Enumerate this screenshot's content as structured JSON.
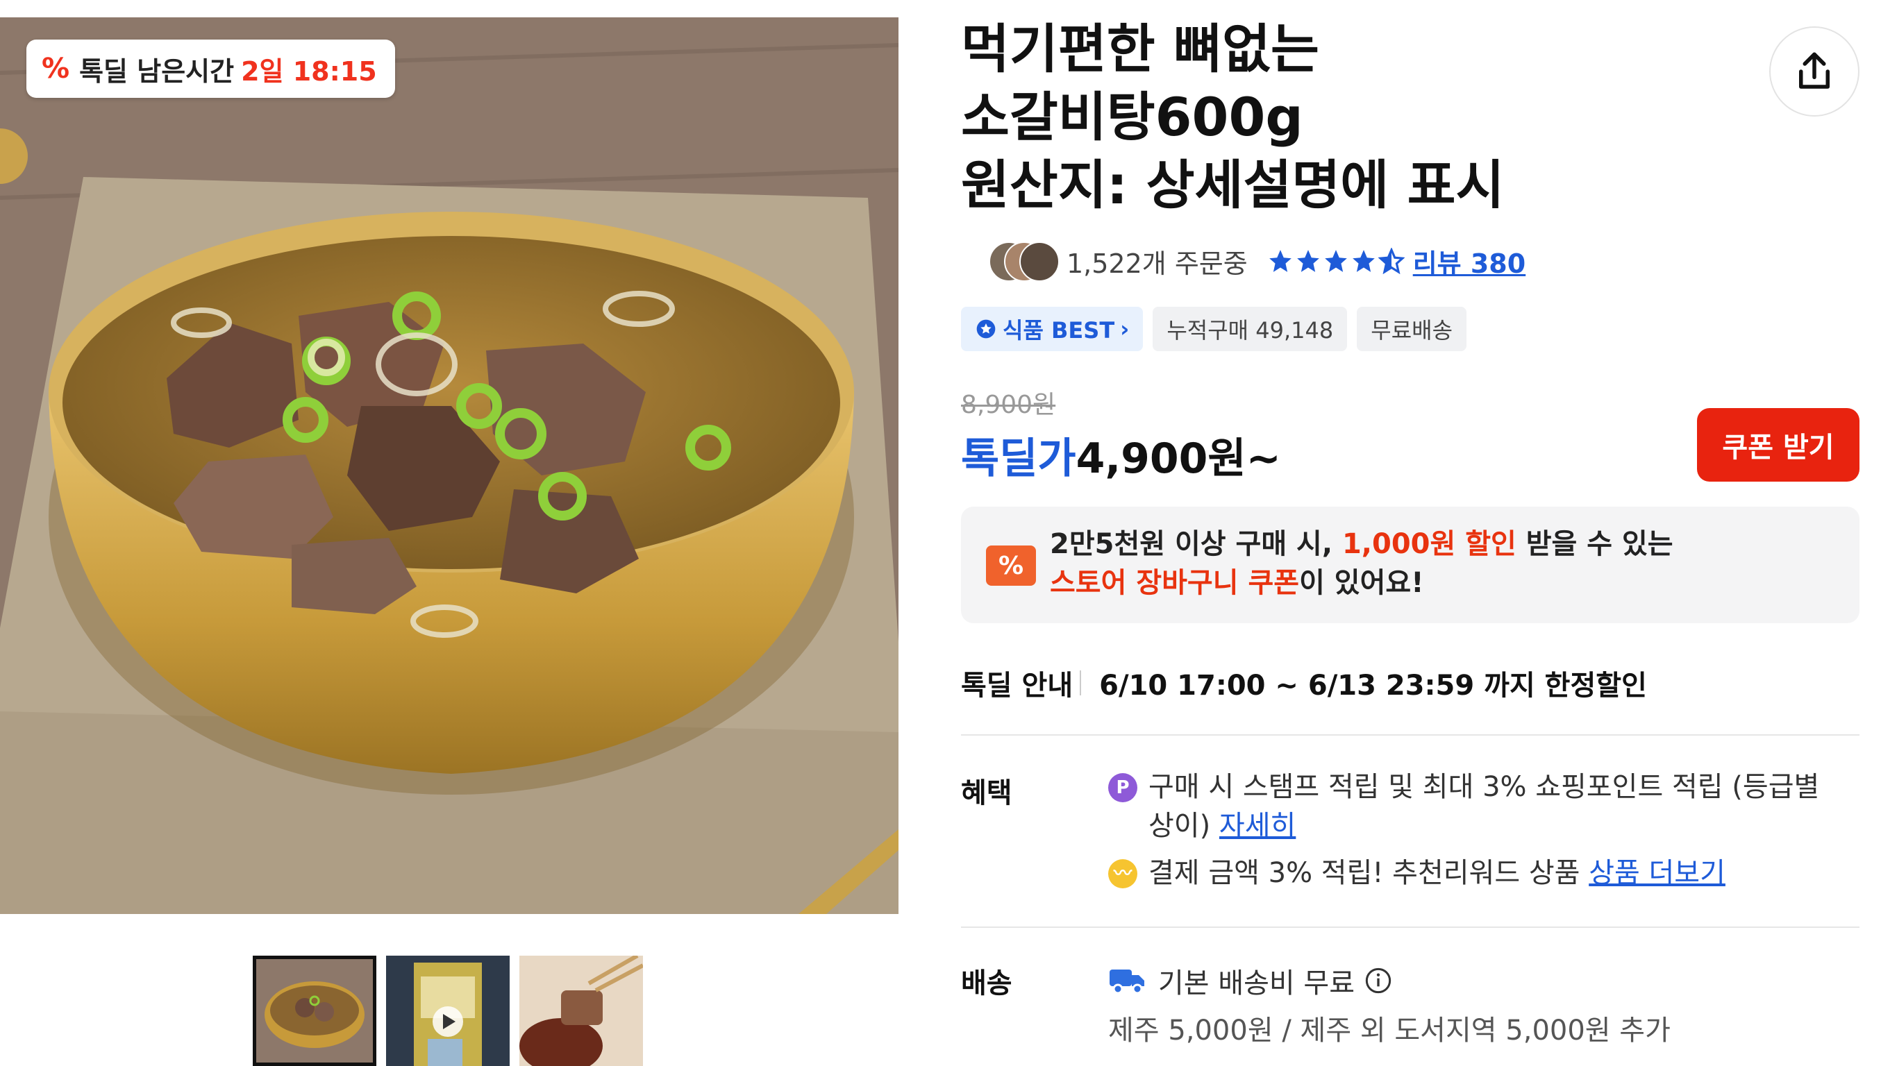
{
  "deal_timer": {
    "label": "톡딜 남은시간",
    "remaining": "2일 18:15"
  },
  "product": {
    "title_lines": [
      "먹기편한 뼈없는",
      "소갈비탕600g",
      "원산지: 상세설명에 표시"
    ]
  },
  "stats": {
    "orders": "1,522개 주문중",
    "rating": 4.5,
    "review_link": "리뷰 380"
  },
  "tags": {
    "best": "식품 BEST",
    "cumulative": "누적구매 49,148",
    "shipping": "무료배송"
  },
  "price": {
    "original": "8,900원",
    "sale_label": "톡딜가",
    "sale_value": "4,900원~"
  },
  "coupon_button": "쿠폰 받기",
  "coupon_banner": {
    "icon": "%",
    "part1": "2만5천원 이상 구매 시, ",
    "part2": "1,000원 할인",
    "part3": " 받을 수 있는",
    "part4": "스토어 장바구니 쿠폰",
    "part5": "이 있어요!"
  },
  "deal_info": {
    "label": "톡딜 안내",
    "period": "6/10 17:00 ~ 6/13 23:59 까지 한정할인"
  },
  "benefits": {
    "label": "혜택",
    "line1_text": "구매 시 스탬프 적립 및 최대 3% 쇼핑포인트 적립 (등급별 상이) ",
    "line1_link": "자세히",
    "line1_icon": "P",
    "line2_text": "결제 금액 3% 적립! 추천리워드 상품 ",
    "line2_link": "상품 더보기"
  },
  "shipping": {
    "label": "배송",
    "line": "기본 배송비 무료",
    "detail": "제주 5,000원 / 제주 외 도서지역 5,000원 추가"
  },
  "colors": {
    "accent_blue": "#1e5bd8",
    "accent_red": "#e8230f",
    "coupon_orange": "#f0622c"
  },
  "icons": [
    "discount-icon",
    "share-icon",
    "star-icon",
    "chevron-right-icon",
    "info-icon",
    "truck-icon",
    "point-icon",
    "reward-icon"
  ]
}
